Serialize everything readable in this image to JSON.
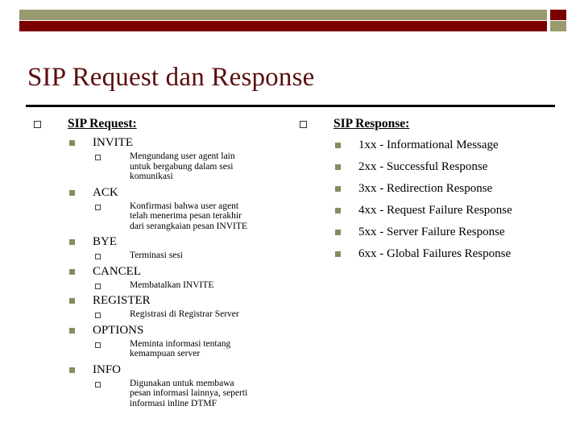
{
  "slide": {
    "title": "SIP Request dan Response",
    "header_decoration": {
      "olive": "#9a9a6e",
      "dark_red": "#7a0000"
    },
    "title_color": "#5b0d0d"
  },
  "left_column": {
    "heading": "SIP Request:",
    "items": [
      {
        "label": "INVITE",
        "detail_lines": [
          "Mengundang user agent lain",
          "untuk bergabung dalam sesi",
          "komunikasi"
        ]
      },
      {
        "label": "ACK",
        "detail_lines": [
          "Konfirmasi bahwa user agent",
          "telah menerima pesan terakhir",
          "dari serangkaian pesan INVITE"
        ]
      },
      {
        "label": "BYE",
        "detail_lines": [
          "Terminasi sesi"
        ]
      },
      {
        "label": "CANCEL",
        "detail_lines": [
          "Membatalkan INVITE"
        ]
      },
      {
        "label": "REGISTER",
        "detail_lines": [
          "Registrasi di Registrar Server"
        ]
      },
      {
        "label": "OPTIONS",
        "detail_lines": [
          "Meminta informasi tentang",
          "kemampuan server"
        ]
      },
      {
        "label": "INFO",
        "detail_lines": [
          "Digunakan untuk membawa",
          "pesan informasi lainnya, seperti",
          "informasi inline DTMF"
        ]
      }
    ]
  },
  "right_column": {
    "heading": "SIP Response:",
    "items": [
      {
        "label": "1xx - Informational Message"
      },
      {
        "label": "2xx - Successful Response"
      },
      {
        "label": "3xx - Redirection Response"
      },
      {
        "label": "4xx - Request Failure Response"
      },
      {
        "label": "5xx - Server Failure Response"
      },
      {
        "label": "6xx - Global Failures Response"
      }
    ]
  }
}
